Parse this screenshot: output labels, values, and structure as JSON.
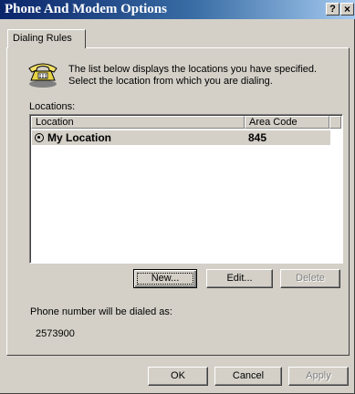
{
  "window": {
    "title": "Phone And Modem Options",
    "help_label": "?",
    "close_label": "×"
  },
  "tabs": [
    {
      "label": "Dialing Rules",
      "selected": true
    }
  ],
  "intro_text": "The list below displays the locations you have specified. Select the location from which you are dialing.",
  "locations": {
    "label": "Locations:",
    "columns": [
      "Location",
      "Area Code"
    ],
    "rows": [
      {
        "location": "My Location",
        "area_code": "845",
        "selected": true
      }
    ]
  },
  "buttons": {
    "new": "New...",
    "edit": "Edit...",
    "delete": "Delete",
    "ok": "OK",
    "cancel": "Cancel",
    "apply": "Apply"
  },
  "dialed_as": {
    "label": "Phone number will be dialed as:",
    "number": "2573900"
  },
  "icons": {
    "phone": "telephone-icon",
    "radio": "radio-selected-icon"
  },
  "colors": {
    "titlebar_start": "#0a246a",
    "titlebar_end": "#a6caf0",
    "face": "#d4d0c8"
  }
}
